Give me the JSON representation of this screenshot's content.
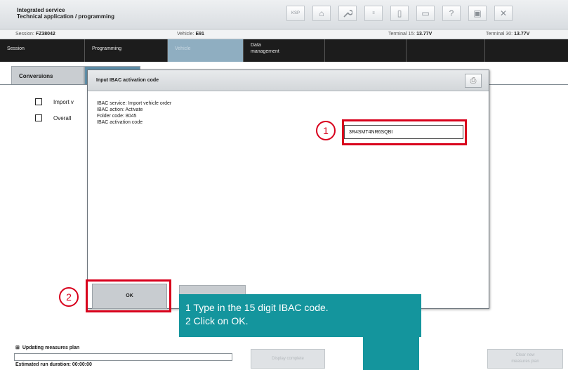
{
  "window": {
    "title_line1": "Integrated service",
    "title_line2": "Technical application / programming",
    "toolbar": [
      {
        "icon": "ksp-icon",
        "text": "KSP"
      },
      {
        "icon": "home-icon",
        "text": "⌂"
      },
      {
        "icon": "wrench-icon",
        "text": "🔧"
      },
      {
        "icon": "tab-icon",
        "text": "≡"
      },
      {
        "icon": "document-icon",
        "text": "▯"
      },
      {
        "icon": "print-icon",
        "text": "▭"
      },
      {
        "icon": "help-icon",
        "text": "?"
      },
      {
        "icon": "minimize-icon",
        "text": "▣"
      },
      {
        "icon": "close-icon",
        "text": "✕"
      }
    ]
  },
  "infobar": {
    "session_label": "Session:",
    "session_value": "FZ38042",
    "vehicle_label": "Vehicle:",
    "vehicle_value": "E91",
    "t15_label": "Terminal 15:",
    "t15_value": "13.77V",
    "t30_label": "Terminal 30:",
    "t30_value": "13.77V"
  },
  "nav": {
    "session": "Session",
    "programming": "Programming",
    "vehicle": "Vehicle",
    "data_line1": "Data",
    "data_line2": "management"
  },
  "subtabs": {
    "conversions": "Conversions"
  },
  "panel": {
    "items": [
      "Import v",
      "Overall"
    ]
  },
  "dialog": {
    "title": "Input IBAC activation code",
    "print_icon": "⎙",
    "service": "IBAC service: Import vehicle order",
    "action": "IBAC action: Activate",
    "folder": "Folder code: 8045",
    "code_label": "IBAC activation code",
    "code_value": "3R4SMT4NR6SQBI",
    "ok": "OK"
  },
  "annotations": {
    "step1": "1",
    "step2": "2",
    "callout_line1": "1 Type in the 15 digit IBAC code.",
    "callout_line2": "2 Click on OK.",
    "color": "#d8001c",
    "callout_color": "#14959d"
  },
  "status": {
    "expand": "⊞",
    "updating": "Updating measures plan",
    "duration": "Estimated run duration: 00:00:00",
    "display_complete": "Display complete",
    "clear_button_line1": "Clear new",
    "clear_button_line2": "measures plan"
  }
}
